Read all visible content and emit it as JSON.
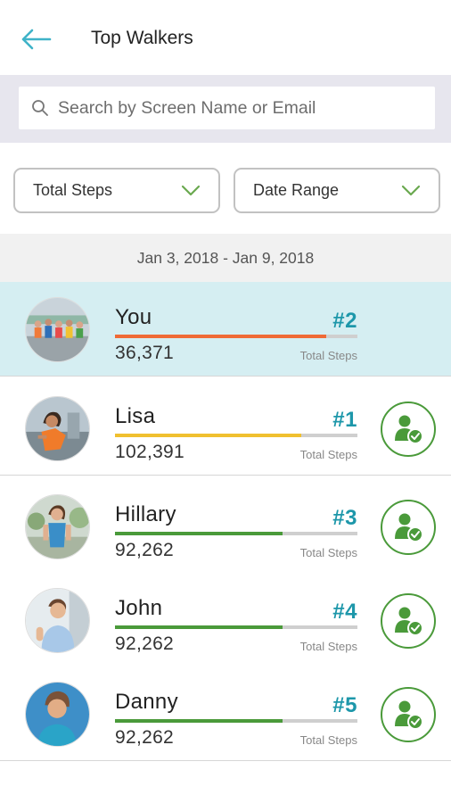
{
  "header": {
    "title": "Top Walkers"
  },
  "search": {
    "placeholder": "Search by Screen Name or Email"
  },
  "filters": {
    "metric": "Total Steps",
    "range": "Date Range"
  },
  "date_range": "Jan 3, 2018 - Jan 9, 2018",
  "steps_label": "Total Steps",
  "colors": {
    "accent": "#1d97aa",
    "me_row": "#d5eef2",
    "bar_orange": "#ef6a36",
    "bar_yellow": "#f0c02f",
    "bar_green": "#4a9a3a",
    "back_arrow": "#3fb3c8"
  },
  "leaderboard": [
    {
      "name": "You",
      "rank": "#2",
      "steps": "36,371",
      "progress": 0.87,
      "bar_color": "#ef6a36",
      "is_me": true
    },
    {
      "name": "Lisa",
      "rank": "#1",
      "steps": "102,391",
      "progress": 0.77,
      "bar_color": "#f0c02f",
      "is_me": false
    },
    {
      "name": "Hillary",
      "rank": "#3",
      "steps": "92,262",
      "progress": 0.69,
      "bar_color": "#4a9a3a",
      "is_me": false
    },
    {
      "name": "John",
      "rank": "#4",
      "steps": "92,262",
      "progress": 0.69,
      "bar_color": "#4a9a3a",
      "is_me": false
    },
    {
      "name": "Danny",
      "rank": "#5",
      "steps": "92,262",
      "progress": 0.69,
      "bar_color": "#4a9a3a",
      "is_me": false
    }
  ]
}
